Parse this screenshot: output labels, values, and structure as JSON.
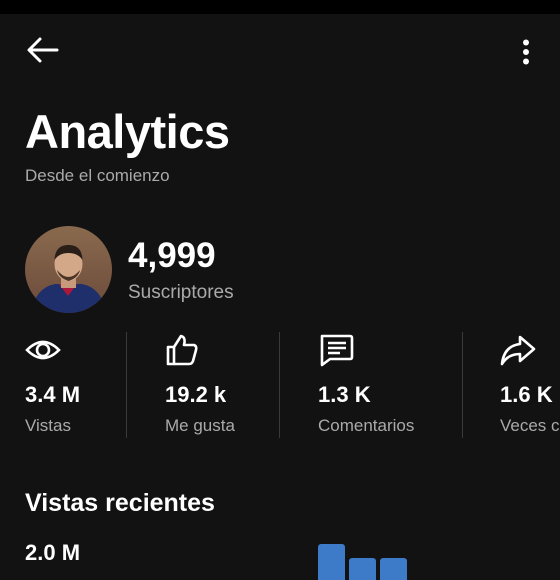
{
  "header": {
    "back_icon": "arrow-left-icon",
    "more_icon": "more-vert-icon",
    "title": "Analytics",
    "subtitle": "Desde el comienzo"
  },
  "channel": {
    "avatar_icon": "channel-avatar",
    "subscribers": "4,999",
    "subscribers_label": "Suscriptores"
  },
  "stats": [
    {
      "icon": "eye-icon",
      "value": "3.4 M",
      "label": "Vistas"
    },
    {
      "icon": "thumb-up-icon",
      "value": "19.2 k",
      "label": "Me gusta"
    },
    {
      "icon": "comment-icon",
      "value": "1.3 K",
      "label": "Comentarios"
    },
    {
      "icon": "share-icon",
      "value": "1.6 K",
      "label": "Veces c"
    }
  ],
  "recent": {
    "title": "Vistas recientes",
    "value": "2.0 M",
    "bar_values": [
      0.9,
      0.55,
      0.55
    ],
    "bar_color": "#3d7ac7"
  },
  "colors": {
    "background": "#121212",
    "text": "#ffffff",
    "secondary_text": "#aaaaaa",
    "divider": "#3a3a3a"
  }
}
